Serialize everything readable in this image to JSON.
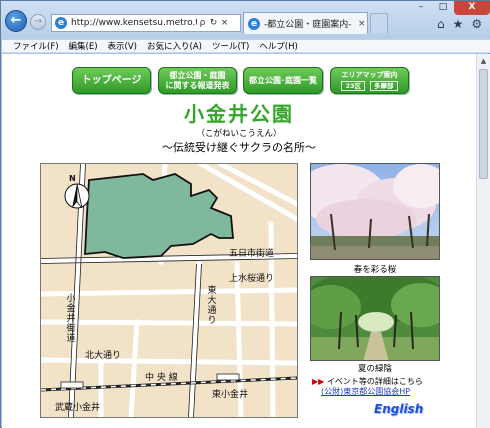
{
  "browser": {
    "url": "http://www.kensetsu.metro.t...",
    "tab_title": "-都立公園・庭園案内-",
    "address_search": "ρ",
    "address_refresh": "↻",
    "address_close": "×",
    "tab_close": "×",
    "window_buttons": {
      "minimize": "–",
      "maximize": "□",
      "close": "X"
    },
    "toolbar_icons": {
      "home": "⌂",
      "favorites": "★",
      "tools": "⚙"
    },
    "back": "←",
    "forward": "→",
    "ie_glyph": "e"
  },
  "menu": [
    "ファイル(F)",
    "編集(E)",
    "表示(V)",
    "お気に入り(A)",
    "ツール(T)",
    "ヘルプ(H)"
  ],
  "nav": {
    "top_page": "トップページ",
    "notice": [
      "都立公園・庭園",
      "に関する報道発表"
    ],
    "list": "都立公園･庭園一覧",
    "area_map": "エリアマップ案内",
    "area_23": "23区",
    "area_tama": "多摩部"
  },
  "park": {
    "name": "小金井公園",
    "reading": "（こがねいこうえん）",
    "tagline": "〜伝統受け継ぐサクラの名所〜"
  },
  "map": {
    "compass": "N",
    "labels": {
      "itsukaichi": "五日市街道",
      "kamimizu": "上水桜通り",
      "koganei_kaido": "小金井街道",
      "higashiohdori": "東大通り",
      "kitaohdori": "北大通り",
      "chuo_line": "中 央 線",
      "musashi_koganei": "武蔵小金井",
      "higashi_koganei": "東小金井"
    },
    "colors": {
      "park": "#7fb89c",
      "ground": "#f1e2c8",
      "road": "#ffffff"
    }
  },
  "photos": {
    "caption_spring": "春を彩る桜",
    "caption_summer": "夏の緑陰"
  },
  "info": {
    "event": "イベント等の詳細はこちら",
    "event_arrow": "▶▶",
    "link": "(公財)東京都公園協会HP",
    "english": "English"
  }
}
